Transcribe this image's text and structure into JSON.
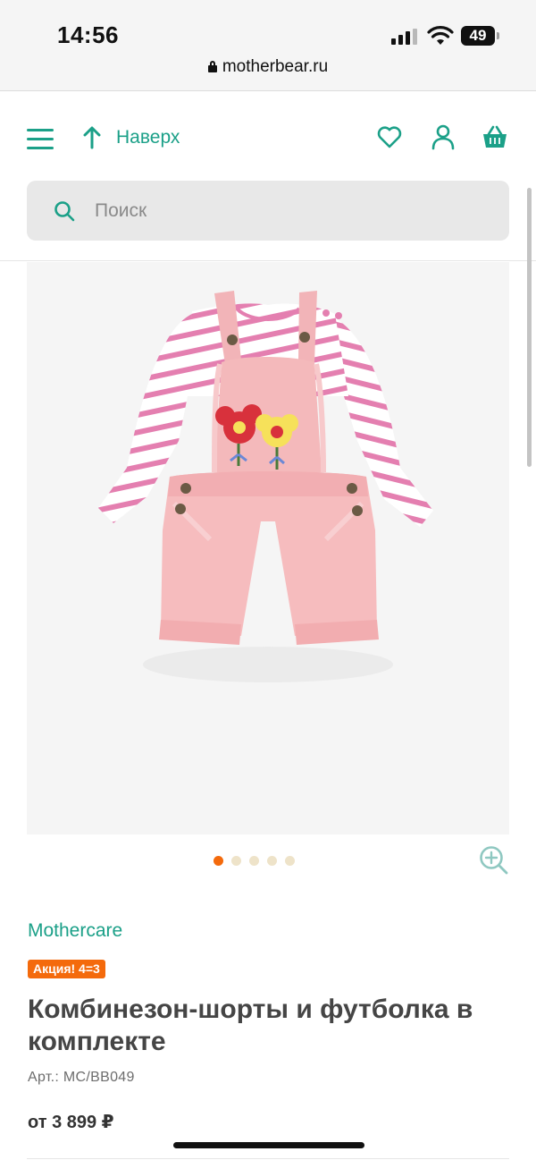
{
  "status_bar": {
    "time": "14:56",
    "battery": "49",
    "url": "motherbear.ru",
    "icons": [
      "signal-icon",
      "wifi-icon",
      "battery-icon",
      "lock-icon"
    ]
  },
  "header": {
    "menu_icon": "hamburger-menu-icon",
    "top_link_label": "Наверх",
    "top_link_icon": "arrow-up-icon",
    "icons": [
      "heart-icon",
      "user-icon",
      "basket-icon"
    ],
    "accent_color": "#1ba088"
  },
  "search": {
    "placeholder": "Поиск",
    "icon": "search-icon"
  },
  "gallery": {
    "image_description": "pink-overalls-striped-top",
    "dots_count": 5,
    "active_index": 0,
    "active_color": "#f46a0c",
    "zoom_icon": "zoom-in-icon"
  },
  "product": {
    "brand": "Mothercare",
    "promo_badge": "Акция! 4=3",
    "title": "Комбинезон-шорты и футболка в комплекте",
    "sku": "Арт.: MC/BB049",
    "price": "от 3 899 ₽"
  }
}
